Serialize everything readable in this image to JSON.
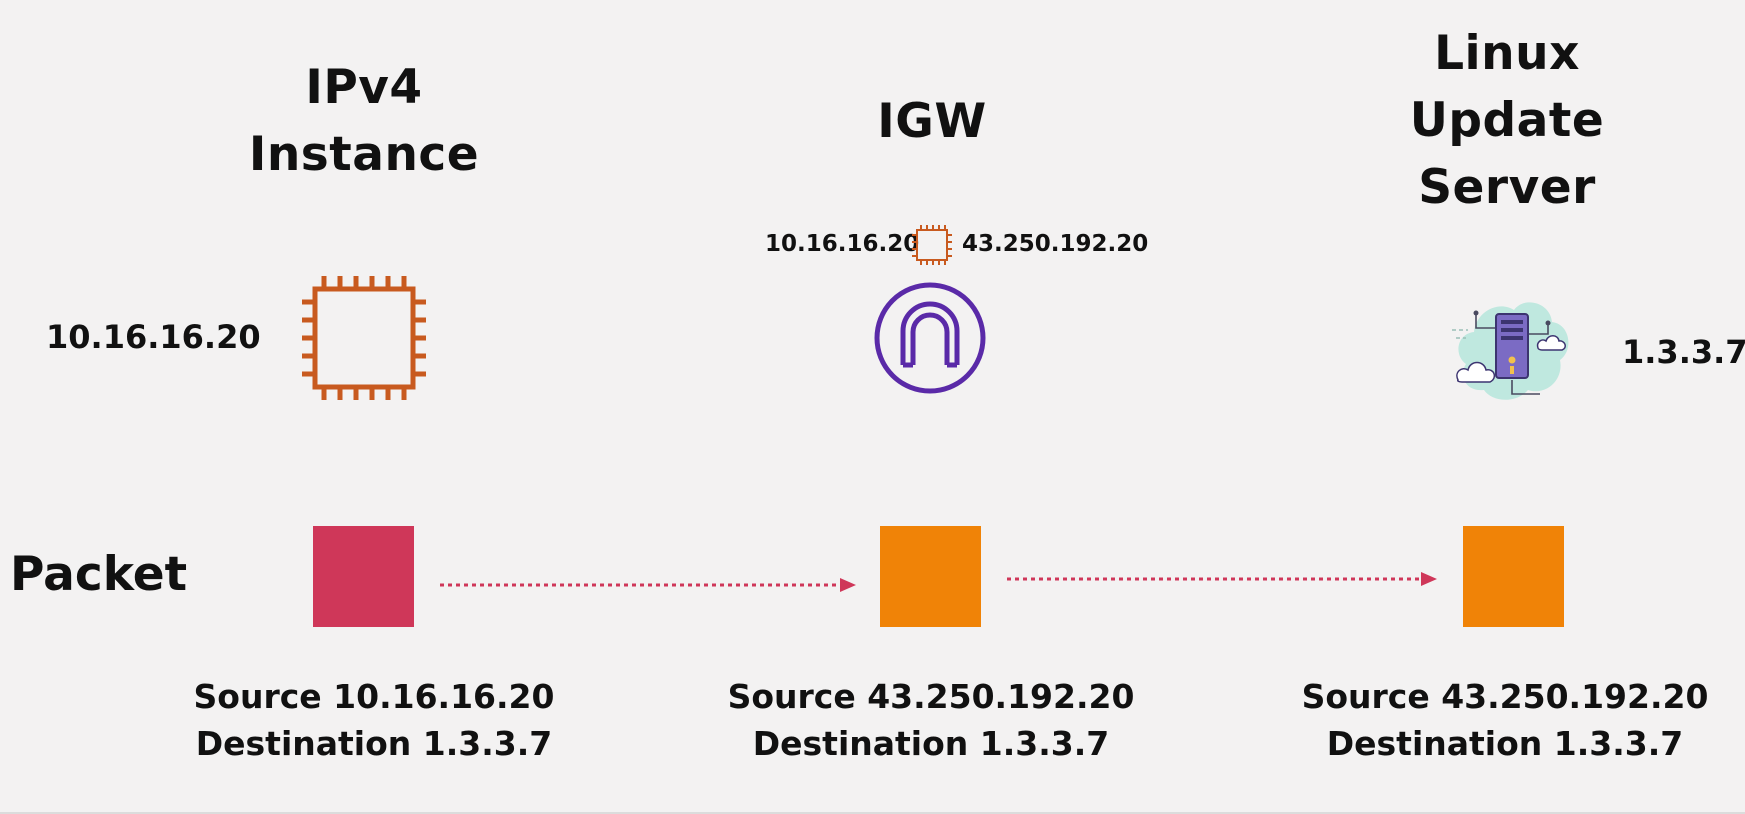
{
  "columns": [
    {
      "id": "instance",
      "heading_lines": [
        "IPv4",
        "Instance"
      ],
      "ip": "10.16.16.20",
      "icon": "ec2-chip-icon",
      "packet_color": "#cf3759",
      "caption": {
        "source": "Source 10.16.16.20",
        "destination": "Destination 1.3.3.7"
      }
    },
    {
      "id": "igw",
      "heading_lines": [
        "IGW"
      ],
      "translation": {
        "private_ip": "10.16.16.20",
        "public_ip": "43.250.192.20"
      },
      "icon": "internet-gateway-icon",
      "packet_color": "#f08307",
      "caption": {
        "source": "Source 43.250.192.20",
        "destination": "Destination 1.3.3.7"
      }
    },
    {
      "id": "server",
      "heading_lines": [
        "Linux",
        "Update",
        "Server"
      ],
      "ip": "1.3.3.7",
      "icon": "cloud-server-icon",
      "packet_color": "#f08307",
      "caption": {
        "source": "Source 43.250.192.20",
        "destination": "Destination 1.3.3.7"
      }
    }
  ],
  "row_label": "Packet",
  "colors": {
    "chip_orange": "#c85a1f",
    "igw_purple": "#5a2aa8",
    "arrow_pink": "#cf3759",
    "background": "#f3f2f2"
  }
}
